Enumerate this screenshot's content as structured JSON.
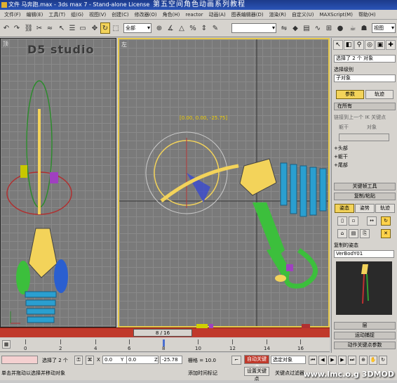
{
  "title_bar": {
    "text": "文件 马奔跑.max - 3ds max 7 - Stand-alone License",
    "watermark": "第五空间角色动画系列教程"
  },
  "menu": {
    "items": [
      "文件(F)",
      "编辑(E)",
      "工具(T)",
      "组(G)",
      "视图(V)",
      "创建(C)",
      "修改器(O)",
      "角色(H)",
      "reactor",
      "动画(A)",
      "图表编辑器(D)",
      "渲染(R)",
      "自定义(U)",
      "MAXScript(M)",
      "帮助(H)"
    ]
  },
  "toolbar": {
    "filter_select": "全部",
    "coord_select": "视图",
    "named_selection": ""
  },
  "viewports": {
    "left_label": "顶",
    "right_label": "左",
    "logo_text": "D5 studio",
    "coord_readout": "[0.00, 0.00, -25.75]"
  },
  "command_panel": {
    "object_count": "选择了 2 个 对象",
    "selection_level_label": "选择级别",
    "sub_object_select": "子对象",
    "tab_params": "参数",
    "tab_track": "轨迹",
    "ik_label": "在所有",
    "ik_checkbox_text": "链接到上一个 IK 关键点",
    "radio_body": "躯干",
    "radio_object": "对象",
    "tree_items": [
      "头部",
      "躯干",
      "尾部"
    ],
    "rollout_key_tools": "关键帧工具",
    "rollout_copy_paste": "复制/粘贴",
    "btn_pose": "姿态",
    "btn_posture": "姿势",
    "btn_track": "轨迹",
    "copied_poses_label": "复制的姿态",
    "copied_pose_value": "VerBodY01",
    "rollout_layers": "层",
    "rollout_motion_capture": "运动捕捉",
    "rollout_bottom": "动作关键点参数"
  },
  "time_slider": {
    "frame_text": "8 / 16"
  },
  "timeline": {
    "ticks": [
      "0",
      "2",
      "4",
      "6",
      "8",
      "10",
      "12",
      "14",
      "16"
    ]
  },
  "status": {
    "selection_text": "选择了 2 个",
    "x_label": "X",
    "x_value": "0.0",
    "y_label": "Y",
    "y_value": "0.0",
    "z_label": "Z",
    "z_value": "-25.78",
    "grid_text": "栅格 = 10.0",
    "auto_key": "自动关键点",
    "set_key": "设置关键点",
    "selection_set": "选定对象",
    "key_filters": "关键点过滤器...",
    "prompt": "单击并拖动以选择并移动对象",
    "add_time_tag": "添加时间标记",
    "bottom_watermark": "www.lmc.o.g  3DMOD"
  },
  "colors": {
    "accent_yellow": "#f3d35a",
    "time_red": "#c0392b",
    "bone_yellow": "#f3d35a",
    "bone_blue": "#2a9fd0",
    "bone_green": "#3cbf3c"
  }
}
